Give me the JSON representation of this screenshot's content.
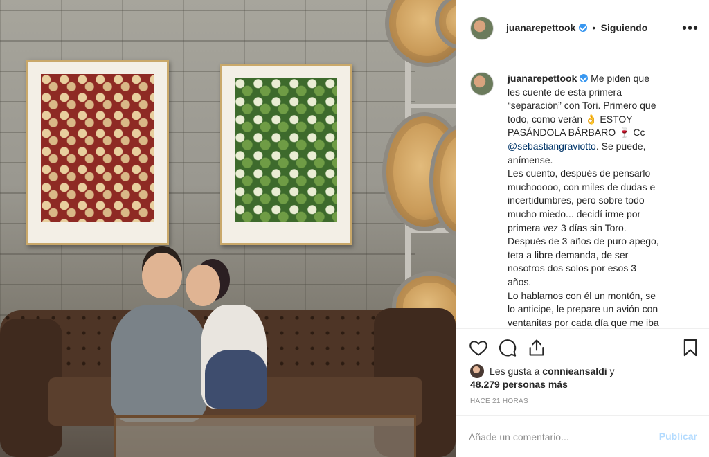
{
  "post": {
    "username": "juanarepettook",
    "follow_status": "Siguiendo",
    "more_glyph": "•••"
  },
  "caption": {
    "username": "juanarepettook",
    "p1_before": "Me piden que les cuente de esta primera “separación” con Tori. Primero que todo, como verán 👌 ESTOY PASÁNDOLA BÁRBARO 🍷 Cc",
    "mention": "@sebastiangraviotto",
    "p1_after": ". Se puede, anímense.",
    "p2": "Les cuento, después de pensarlo muchooooo, con miles de dudas e incertidumbres, pero sobre todo mucho miedo... decidí irme por primera vez 3 días sin Toro. Después de 3 años de puro apego, teta a libre demanda, de ser nosotros dos solos por esos 3 años.",
    "p3": "Lo hablamos con él un montón, se lo anticipe, le prepare un avión con ventanitas por cada día que me iba para que fuera tachando con un"
  },
  "likes": {
    "prefix": "Les gusta a",
    "user": "connieansaldi",
    "conj": "y",
    "count": "48.279 personas más"
  },
  "timestamp": "HACE 21 HORAS",
  "comment": {
    "placeholder": "Añade un comentario...",
    "publish": "Publicar"
  },
  "icons": {
    "like": "heart-icon",
    "comment": "comment-icon",
    "share": "share-icon",
    "save": "bookmark-icon"
  },
  "colors": {
    "verified": "#3897f0",
    "link": "#003569",
    "publish_disabled": "#b3dbff",
    "muted": "#8e8e8e"
  }
}
